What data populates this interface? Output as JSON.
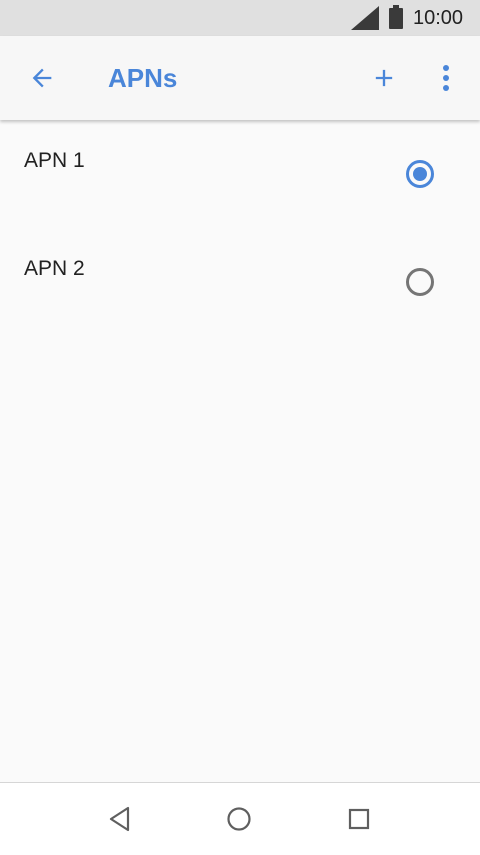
{
  "status_bar": {
    "time": "10:00",
    "icons": [
      "cell-signal-icon",
      "battery-icon"
    ]
  },
  "app_bar": {
    "title": "APNs",
    "back_icon": "arrow-left-icon",
    "add_icon": "plus-icon",
    "more_icon": "more-vertical-icon"
  },
  "apns": [
    {
      "label": "APN 1",
      "selected": true
    },
    {
      "label": "APN 2",
      "selected": false
    }
  ],
  "nav_bar": {
    "icons": [
      "back-triangle-icon",
      "home-circle-icon",
      "recents-square-icon"
    ]
  },
  "colors": {
    "accent": "#4a86d9",
    "status_bar_bg": "#e0e0e0",
    "background": "#fafafa",
    "text_primary": "#212121",
    "radio_unselected": "#757575"
  }
}
